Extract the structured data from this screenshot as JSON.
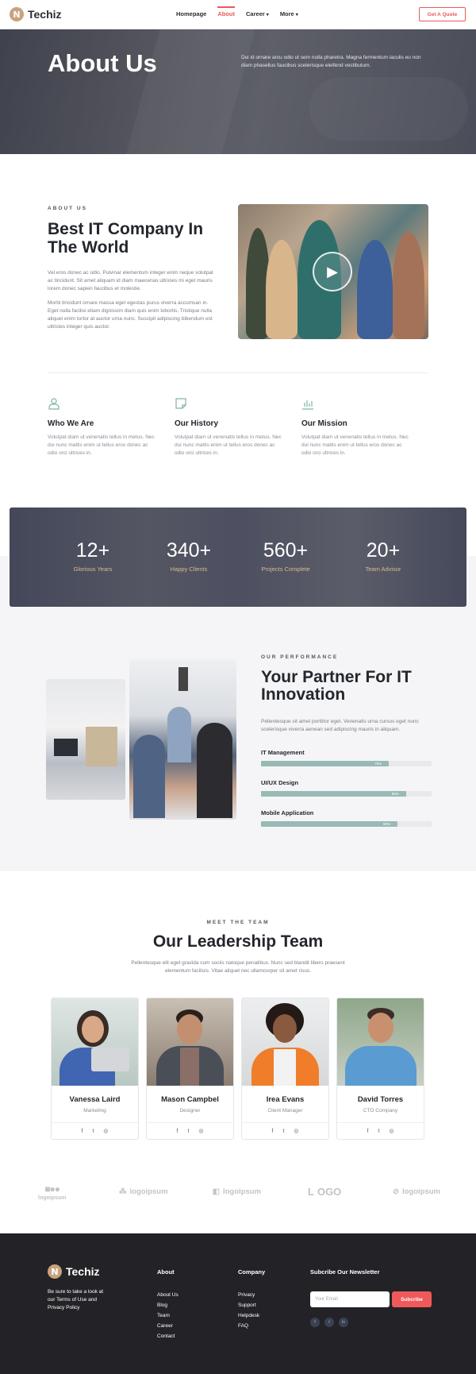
{
  "nav": {
    "brand": "Techiz",
    "items": [
      {
        "label": "Homepage"
      },
      {
        "label": "About"
      },
      {
        "label": "Career"
      },
      {
        "label": "More"
      }
    ],
    "cta": "Get A Quote",
    "colors": {
      "accent": "#e85a57",
      "brand": "#c9a27e"
    }
  },
  "hero": {
    "title": "About Us",
    "text": "Dui id ornare arcu odio ut sem nulla pharetra. Magna fermentum iaculis eu non diam phasellus faucibus scelerisque eleifend vestibulum."
  },
  "about": {
    "eyebrow": "ABOUT US",
    "title": "Best IT Company In The World",
    "p1": "Vel eros donec ac odio. Pulvinar elementum integer enim neque volutpat ac tincidunt. Sit amet aliquam id diam maecenas ultricies mi eget mauris lorem donec sapien faucibus et molestie.",
    "p2": "Morbi tincidunt ornare massa eget egestas purus viverra accumsan in. Eget nulla facilisi etiam dignissim diam quis enim lobortis. Tristique nulla aliquet enim tortor at auctor urna nunc. Suscipit adipiscing bibendum est ultricies integer quis auctor."
  },
  "features": [
    {
      "icon": "user-icon",
      "title": "Who We Are",
      "text": "Volutpat diam ut venenatis tellus in metus. Nec dui nunc mattis enim ut tellus eros donec ac odio orci ultrices in."
    },
    {
      "icon": "notebook-icon",
      "title": "Our History",
      "text": "Volutpat diam ut venenatis tellus in metus. Nec dui nunc mattis enim ut tellus eros donec ac odio orci ultrices in."
    },
    {
      "icon": "bar-chart-icon",
      "title": "Our Mission",
      "text": "Volutpat diam ut venenatis tellus in metus. Nec dui nunc mattis enim ut tellus eros donec ac odio orci ultrices in."
    }
  ],
  "stats": [
    {
      "value": "12+",
      "label": "Glorious Years"
    },
    {
      "value": "340+",
      "label": "Happy Clients"
    },
    {
      "value": "560+",
      "label": "Projects Complete"
    },
    {
      "value": "20+",
      "label": "Team Advisor"
    }
  ],
  "performance": {
    "eyebrow": "OUR PERFORMANCE",
    "title": "Your Partner For IT Innovation",
    "text": "Pellentesque sit amet porttitor eget. Venenatis urna cursus eget nunc scelerisque viverra aenean sed adipiscing mauris in aliquam.",
    "skills": [
      {
        "label": "IT Management",
        "percent": 75,
        "percent_label": "75%"
      },
      {
        "label": "UI/UX Design",
        "percent": 85,
        "percent_label": "85%"
      },
      {
        "label": "Mobile Application",
        "percent": 80,
        "percent_label": "80%"
      }
    ]
  },
  "team": {
    "eyebrow": "MEET THE TEAM",
    "title": "Our Leadership Team",
    "text": "Pellentesque elit eget gravida cum sociis natoque penatibus. Nunc sed blandit libero praesent elementum facilisis. Vitae aliquet nec ullamcorper sit amet risus.",
    "members": [
      {
        "name": "Vanessa Laird",
        "role": "Marketing"
      },
      {
        "name": "Mason Campbel",
        "role": "Designer"
      },
      {
        "name": "Irea Evans",
        "role": "Client Manager"
      },
      {
        "name": "David Torres",
        "role": "CTO Company"
      }
    ]
  },
  "logos": [
    {
      "text": "logoipsum"
    },
    {
      "text": "logoipsum"
    },
    {
      "text": "logoipsum"
    },
    {
      "text": "OGO"
    },
    {
      "text": "logoipsum"
    }
  ],
  "footer": {
    "brand": "Techiz",
    "desc": "Be sure to take a look at our Terms of Use and Privacy Policy",
    "about": {
      "title": "About",
      "links": [
        "About Us",
        "Blog",
        "Team",
        "Career",
        "Contact"
      ]
    },
    "company": {
      "title": "Company",
      "links": [
        "Privacy",
        "Support",
        "Helpdesk",
        "FAQ"
      ]
    },
    "newsletter": {
      "title": "Subcribe Our Newsletter",
      "placeholder": "Your Email",
      "button": "Subcribe"
    }
  }
}
